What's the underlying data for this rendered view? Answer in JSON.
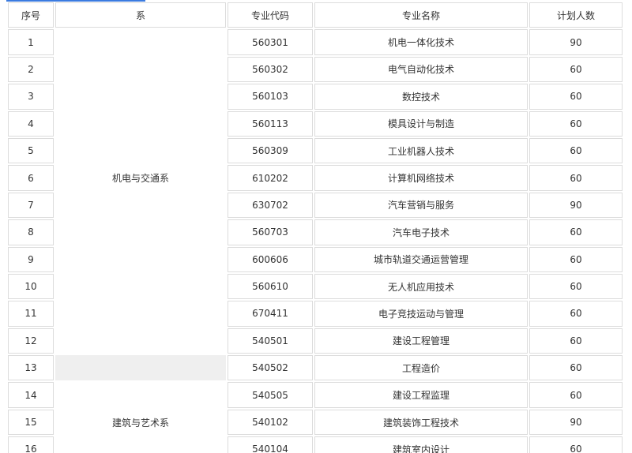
{
  "table": {
    "headers": {
      "index": "序号",
      "department": "系",
      "code": "专业代码",
      "name": "专业名称",
      "quota": "计划人数"
    },
    "departments": {
      "mech": "机电与交通系",
      "arch": "建筑与艺术系"
    },
    "rows": [
      {
        "index": "1",
        "code": "560301",
        "name": "机电一体化技术",
        "quota": "90"
      },
      {
        "index": "2",
        "code": "560302",
        "name": "电气自动化技术",
        "quota": "60"
      },
      {
        "index": "3",
        "code": "560103",
        "name": "数控技术",
        "quota": "60"
      },
      {
        "index": "4",
        "code": "560113",
        "name": "模具设计与制造",
        "quota": "60"
      },
      {
        "index": "5",
        "code": "560309",
        "name": "工业机器人技术",
        "quota": "60"
      },
      {
        "index": "6",
        "code": "610202",
        "name": "计算机网络技术",
        "quota": "60"
      },
      {
        "index": "7",
        "code": "630702",
        "name": "汽车营销与服务",
        "quota": "90"
      },
      {
        "index": "8",
        "code": "560703",
        "name": "汽车电子技术",
        "quota": "60"
      },
      {
        "index": "9",
        "code": "600606",
        "name": "城市轨道交通运营管理",
        "quota": "60"
      },
      {
        "index": "10",
        "code": "560610",
        "name": "无人机应用技术",
        "quota": "60"
      },
      {
        "index": "11",
        "code": "670411",
        "name": "电子竞技运动与管理",
        "quota": "60"
      },
      {
        "index": "12",
        "code": "540501",
        "name": "建设工程管理",
        "quota": "60"
      },
      {
        "index": "13",
        "code": "540502",
        "name": "工程造价",
        "quota": "60"
      },
      {
        "index": "14",
        "code": "540505",
        "name": "建设工程监理",
        "quota": "60"
      },
      {
        "index": "15",
        "code": "540102",
        "name": "建筑装饰工程技术",
        "quota": "90"
      },
      {
        "index": "16",
        "code": "540104",
        "name": "建筑室内设计",
        "quota": "60"
      }
    ]
  }
}
